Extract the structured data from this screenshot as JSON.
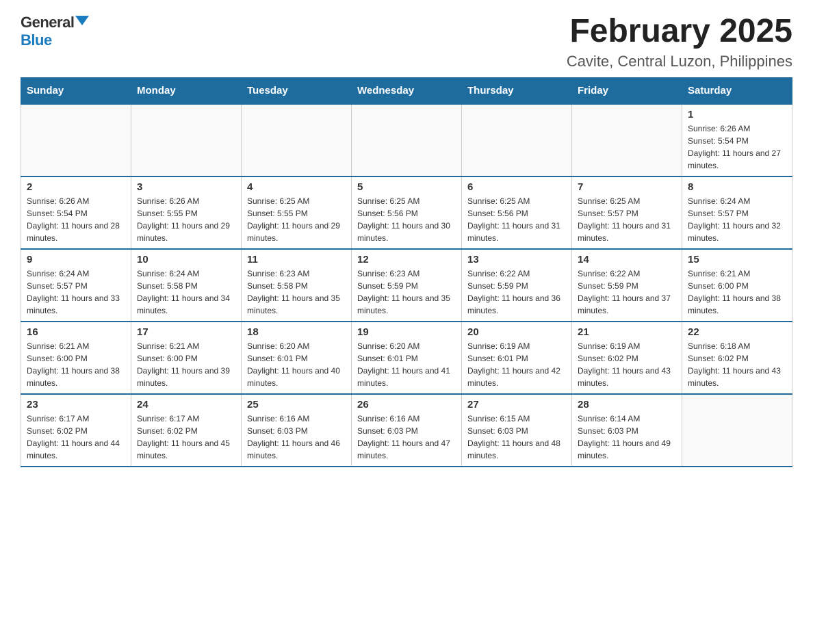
{
  "logo": {
    "general": "General",
    "blue": "Blue"
  },
  "header": {
    "month": "February 2025",
    "location": "Cavite, Central Luzon, Philippines"
  },
  "days_of_week": [
    "Sunday",
    "Monday",
    "Tuesday",
    "Wednesday",
    "Thursday",
    "Friday",
    "Saturday"
  ],
  "weeks": [
    [
      {
        "day": "",
        "info": ""
      },
      {
        "day": "",
        "info": ""
      },
      {
        "day": "",
        "info": ""
      },
      {
        "day": "",
        "info": ""
      },
      {
        "day": "",
        "info": ""
      },
      {
        "day": "",
        "info": ""
      },
      {
        "day": "1",
        "info": "Sunrise: 6:26 AM\nSunset: 5:54 PM\nDaylight: 11 hours and 27 minutes."
      }
    ],
    [
      {
        "day": "2",
        "info": "Sunrise: 6:26 AM\nSunset: 5:54 PM\nDaylight: 11 hours and 28 minutes."
      },
      {
        "day": "3",
        "info": "Sunrise: 6:26 AM\nSunset: 5:55 PM\nDaylight: 11 hours and 29 minutes."
      },
      {
        "day": "4",
        "info": "Sunrise: 6:25 AM\nSunset: 5:55 PM\nDaylight: 11 hours and 29 minutes."
      },
      {
        "day": "5",
        "info": "Sunrise: 6:25 AM\nSunset: 5:56 PM\nDaylight: 11 hours and 30 minutes."
      },
      {
        "day": "6",
        "info": "Sunrise: 6:25 AM\nSunset: 5:56 PM\nDaylight: 11 hours and 31 minutes."
      },
      {
        "day": "7",
        "info": "Sunrise: 6:25 AM\nSunset: 5:57 PM\nDaylight: 11 hours and 31 minutes."
      },
      {
        "day": "8",
        "info": "Sunrise: 6:24 AM\nSunset: 5:57 PM\nDaylight: 11 hours and 32 minutes."
      }
    ],
    [
      {
        "day": "9",
        "info": "Sunrise: 6:24 AM\nSunset: 5:57 PM\nDaylight: 11 hours and 33 minutes."
      },
      {
        "day": "10",
        "info": "Sunrise: 6:24 AM\nSunset: 5:58 PM\nDaylight: 11 hours and 34 minutes."
      },
      {
        "day": "11",
        "info": "Sunrise: 6:23 AM\nSunset: 5:58 PM\nDaylight: 11 hours and 35 minutes."
      },
      {
        "day": "12",
        "info": "Sunrise: 6:23 AM\nSunset: 5:59 PM\nDaylight: 11 hours and 35 minutes."
      },
      {
        "day": "13",
        "info": "Sunrise: 6:22 AM\nSunset: 5:59 PM\nDaylight: 11 hours and 36 minutes."
      },
      {
        "day": "14",
        "info": "Sunrise: 6:22 AM\nSunset: 5:59 PM\nDaylight: 11 hours and 37 minutes."
      },
      {
        "day": "15",
        "info": "Sunrise: 6:21 AM\nSunset: 6:00 PM\nDaylight: 11 hours and 38 minutes."
      }
    ],
    [
      {
        "day": "16",
        "info": "Sunrise: 6:21 AM\nSunset: 6:00 PM\nDaylight: 11 hours and 38 minutes."
      },
      {
        "day": "17",
        "info": "Sunrise: 6:21 AM\nSunset: 6:00 PM\nDaylight: 11 hours and 39 minutes."
      },
      {
        "day": "18",
        "info": "Sunrise: 6:20 AM\nSunset: 6:01 PM\nDaylight: 11 hours and 40 minutes."
      },
      {
        "day": "19",
        "info": "Sunrise: 6:20 AM\nSunset: 6:01 PM\nDaylight: 11 hours and 41 minutes."
      },
      {
        "day": "20",
        "info": "Sunrise: 6:19 AM\nSunset: 6:01 PM\nDaylight: 11 hours and 42 minutes."
      },
      {
        "day": "21",
        "info": "Sunrise: 6:19 AM\nSunset: 6:02 PM\nDaylight: 11 hours and 43 minutes."
      },
      {
        "day": "22",
        "info": "Sunrise: 6:18 AM\nSunset: 6:02 PM\nDaylight: 11 hours and 43 minutes."
      }
    ],
    [
      {
        "day": "23",
        "info": "Sunrise: 6:17 AM\nSunset: 6:02 PM\nDaylight: 11 hours and 44 minutes."
      },
      {
        "day": "24",
        "info": "Sunrise: 6:17 AM\nSunset: 6:02 PM\nDaylight: 11 hours and 45 minutes."
      },
      {
        "day": "25",
        "info": "Sunrise: 6:16 AM\nSunset: 6:03 PM\nDaylight: 11 hours and 46 minutes."
      },
      {
        "day": "26",
        "info": "Sunrise: 6:16 AM\nSunset: 6:03 PM\nDaylight: 11 hours and 47 minutes."
      },
      {
        "day": "27",
        "info": "Sunrise: 6:15 AM\nSunset: 6:03 PM\nDaylight: 11 hours and 48 minutes."
      },
      {
        "day": "28",
        "info": "Sunrise: 6:14 AM\nSunset: 6:03 PM\nDaylight: 11 hours and 49 minutes."
      },
      {
        "day": "",
        "info": ""
      }
    ]
  ]
}
